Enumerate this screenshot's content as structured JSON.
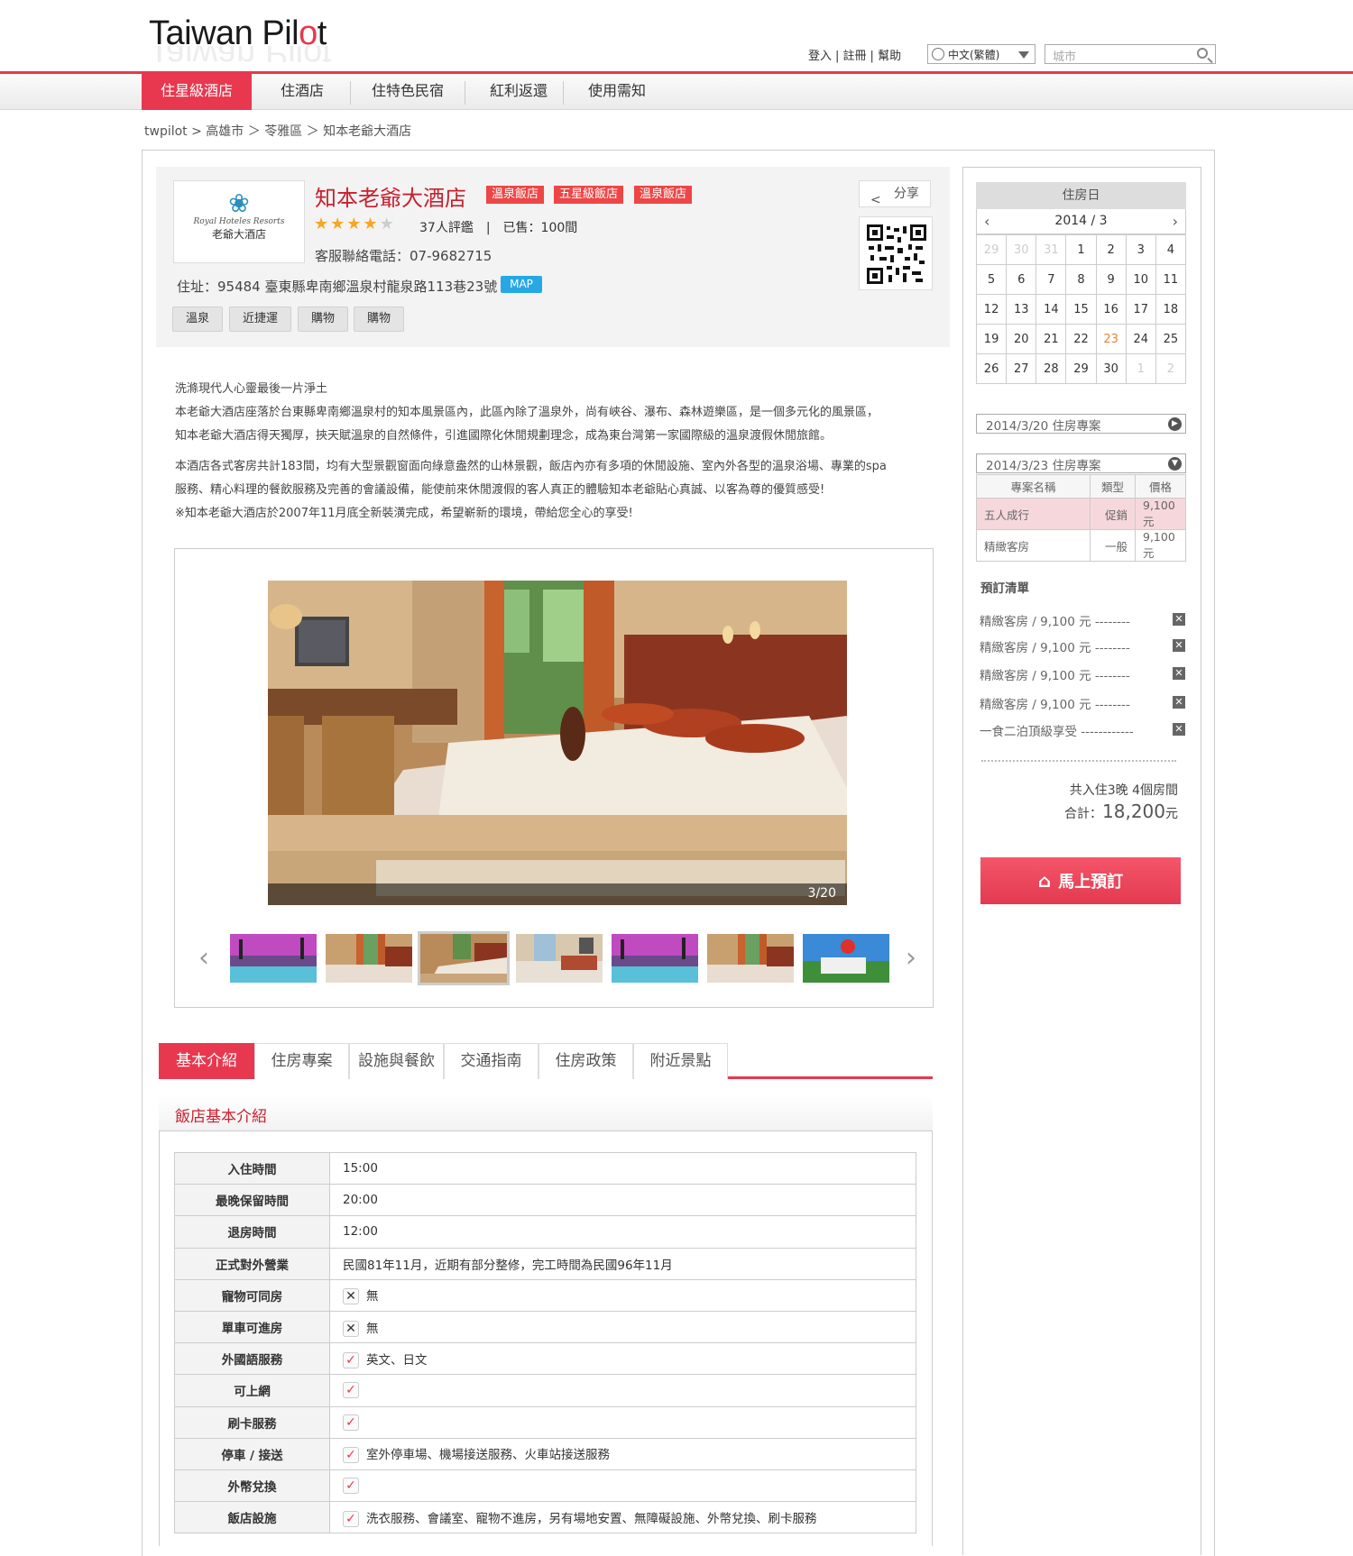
{
  "header": {
    "logo_text_a": "Taiwan Pil",
    "logo_text_o": "o",
    "logo_text_b": "t",
    "links": [
      "登入",
      "註冊",
      "幫助"
    ],
    "language": "中文(繁體)",
    "search_placeholder": "城市"
  },
  "nav": {
    "items": [
      "住星級酒店",
      "住酒店",
      "住特色民宿",
      "紅利返還",
      "使用需知"
    ],
    "active_index": 0
  },
  "breadcrumb": "twpilot > 高雄市 ＞ 苓雅區 ＞ 知本老爺大酒店",
  "hotel": {
    "logo_line1": "Royal Hoteles Resorts",
    "logo_line2": "老爺大酒店",
    "name": "知本老爺大酒店",
    "tags": [
      "溫泉飯店",
      "五星級飯店",
      "溫泉飯店"
    ],
    "stars": 4,
    "reviews": "37人評鑑",
    "sold": "已售：100間",
    "phone": "客服聯絡電話：07-9682715",
    "address": "住址：95484 臺東縣卑南鄉溫泉村龍泉路113巷23號",
    "map_label": "MAP",
    "feature_tags": [
      "溫泉",
      "近捷運",
      "購物",
      "購物"
    ],
    "share_label": "分享"
  },
  "description": {
    "p1_lines": [
      "洗滌現代人心靈最後一片淨土",
      "本老爺大酒店座落於台東縣卑南鄉溫泉村的知本風景區內，此區內除了溫泉外，尚有峽谷、瀑布、森林遊樂區，是一個多元化的風景區，",
      "知本老爺大酒店得天獨厚，挾天賦溫泉的自然條件，引進國際化休閒規劃理念，成為東台灣第一家國際級的溫泉渡假休閒旅館。"
    ],
    "p2_lines": [
      "本酒店各式客房共計183間，均有大型景觀窗面向綠意盎然的山林景觀，飯店內亦有多項的休閒設施、室內外各型的溫泉浴場、專業的spa",
      "服務、精心料理的餐飲服務及完善的會議設備，能使前來休閒渡假的客人真正的體驗知本老爺貼心真誠、以客為尊的優質感受!",
      "※知本老爺大酒店於2007年11月底全新裝潢完成，希望嶄新的環境，帶給您全心的享受!"
    ]
  },
  "gallery": {
    "counter": "3/20",
    "current": 3,
    "total": 20,
    "active_thumb": 2
  },
  "tabs": {
    "items": [
      "基本介紹",
      "住房專案",
      "設施與餐飲",
      "交通指南",
      "住房政策",
      "附近景點"
    ],
    "active_index": 0
  },
  "info_section": {
    "title": "飯店基本介紹",
    "rows": [
      {
        "key": "入住時間",
        "value": "15:00",
        "check": ""
      },
      {
        "key": "最晚保留時間",
        "value": "20:00",
        "check": ""
      },
      {
        "key": "退房時間",
        "value": "12:00",
        "check": ""
      },
      {
        "key": "正式對外營業",
        "value": "民國81年11月，近期有部分整修，完工時間為民國96年11月",
        "check": ""
      },
      {
        "key": "寵物可同房",
        "value": "無",
        "check": "x"
      },
      {
        "key": "單車可進房",
        "value": "無",
        "check": "x"
      },
      {
        "key": "外國語服務",
        "value": "英文、日文",
        "check": "v"
      },
      {
        "key": "可上網",
        "value": "",
        "check": "v"
      },
      {
        "key": "刷卡服務",
        "value": "",
        "check": "v"
      },
      {
        "key": "停車 / 接送",
        "value": "室外停車場、機場接送服務、火車站接送服務",
        "check": "v"
      },
      {
        "key": "外幣兌換",
        "value": "",
        "check": "v"
      },
      {
        "key": "飯店設施",
        "value": "洗衣服務、會議室、寵物不進房，另有場地安置、無障礙設施、外幣兌換、刷卡服務",
        "check": "v"
      }
    ]
  },
  "calendar": {
    "title": "住房日",
    "month": "2014 / 3",
    "weeks": [
      [
        "29",
        "30",
        "31",
        "1",
        "2",
        "3",
        "4"
      ],
      [
        "5",
        "6",
        "7",
        "8",
        "9",
        "10",
        "11"
      ],
      [
        "12",
        "13",
        "14",
        "15",
        "16",
        "17",
        "18"
      ],
      [
        "19",
        "20",
        "21",
        "22",
        "23",
        "24",
        "25"
      ],
      [
        "26",
        "27",
        "28",
        "29",
        "30",
        "1",
        "2"
      ]
    ],
    "today": "23"
  },
  "plans": {
    "plan_a": "2014/3/20 住房專案",
    "plan_b": "2014/3/23 住房專案",
    "headers": [
      "專案名稱",
      "類型",
      "價格"
    ],
    "rows": [
      {
        "name": "五人成行",
        "type": "促銷",
        "price": "9,100元"
      },
      {
        "name": "精緻客房",
        "type": "一般",
        "price": "9,100元"
      }
    ]
  },
  "booking": {
    "title": "預訂清單",
    "items": [
      "精緻客房 / 9,100 元 --------",
      "精緻客房 / 9,100 元 --------",
      "精緻客房 / 9,100 元 --------",
      "精緻客房 / 9,100 元 --------",
      "一食二泊頂級享受 ------------"
    ],
    "stay_summary": "共入住3晚 4個房間",
    "total_label": "合計：",
    "total_value": "18,200",
    "total_unit": "元",
    "book_button": "馬上預訂"
  },
  "colors": {
    "accent": "#e8384f",
    "star": "#f6a623",
    "map_blue": "#27a8e4"
  }
}
